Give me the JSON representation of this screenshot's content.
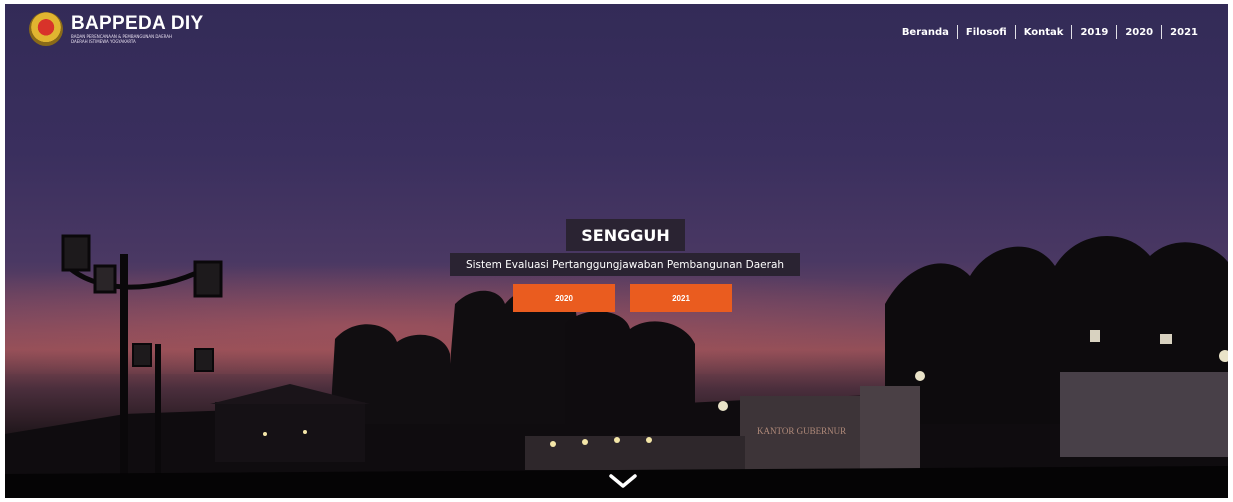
{
  "brand": {
    "name": "BAPPEDA DIY",
    "subtitle_line1": "BADAN PERENCANAAN & PEMBANGUNAN DAERAH",
    "subtitle_line2": "DAERAH ISTIMEWA YOGYAKARTA"
  },
  "nav": {
    "items": [
      "Beranda",
      "Filosofi",
      "Kontak",
      "2019",
      "2020",
      "2021"
    ]
  },
  "hero": {
    "title": "SENGGUH",
    "subtitle": "Sistem Evaluasi Pertanggungjawaban Pembangunan Daerah",
    "buttons": [
      "2020",
      "2021"
    ]
  },
  "scene": {
    "sign_text": "KANTOR GUBERNUR"
  },
  "icons": {
    "scroll_down": "chevron-down-icon",
    "logo": "bappeda-emblem-icon"
  },
  "colors": {
    "accent": "#ea5c1f",
    "label_bg": "#2a2332",
    "sky_top": "#332b57",
    "sky_sunset": "#8f4e58"
  }
}
